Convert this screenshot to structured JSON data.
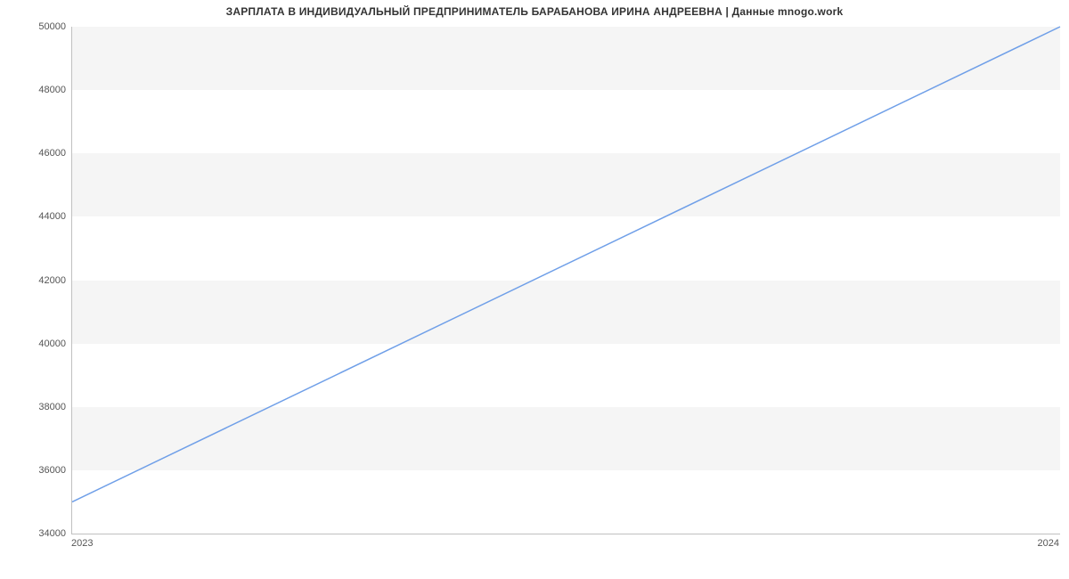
{
  "chart_data": {
    "type": "line",
    "title": "ЗАРПЛАТА В ИНДИВИДУАЛЬНЫЙ ПРЕДПРИНИМАТЕЛЬ БАРАБАНОВА ИРИНА АНДРЕЕВНА | Данные mnogo.work",
    "x": [
      2023,
      2024
    ],
    "values": [
      35000,
      50000
    ],
    "x_ticks": [
      2023,
      2024
    ],
    "y_ticks": [
      34000,
      36000,
      38000,
      40000,
      42000,
      44000,
      46000,
      48000,
      50000
    ],
    "xlim": [
      2023,
      2024
    ],
    "ylim": [
      34000,
      50000
    ],
    "line_color": "#6f9fe8",
    "band_color": "#f5f5f5",
    "xlabel": "",
    "ylabel": ""
  }
}
